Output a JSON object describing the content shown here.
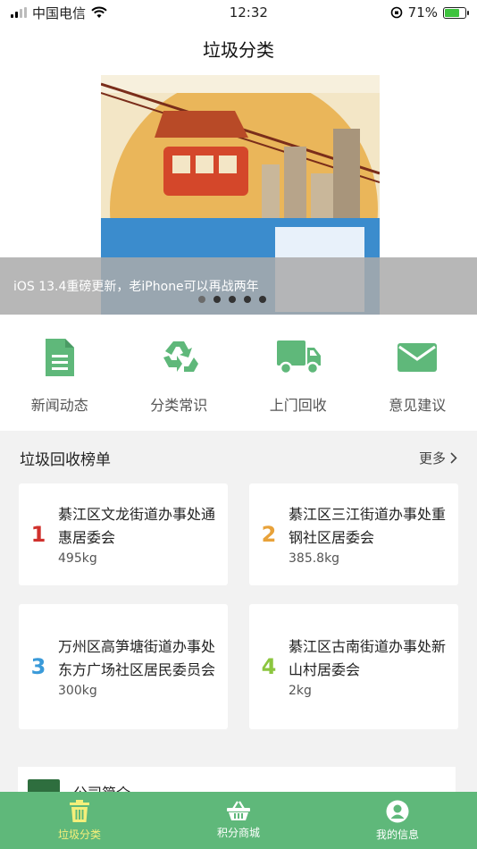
{
  "status_bar": {
    "carrier": "中国电信",
    "time": "12:32",
    "battery": "71%"
  },
  "nav": {
    "title": "垃圾分类"
  },
  "banner": {
    "caption": "iOS 13.4重磅更新，老iPhone可以再战两年",
    "slide_count": 5,
    "active_index": 0
  },
  "quick_menu": [
    {
      "label": "新闻动态",
      "icon": "document-icon"
    },
    {
      "label": "分类常识",
      "icon": "recycle-icon"
    },
    {
      "label": "上门回收",
      "icon": "truck-icon"
    },
    {
      "label": "意见建议",
      "icon": "envelope-icon"
    }
  ],
  "ranking": {
    "title": "垃圾回收榜单",
    "more": "更多",
    "items": [
      {
        "rank": "1",
        "name": "綦江区文龙街道办事处通惠居委会",
        "weight": "495kg",
        "color": "#d0312d"
      },
      {
        "rank": "2",
        "name": "綦江区三江街道办事处重钢社区居委会",
        "weight": "385.8kg",
        "color": "#e8a23a"
      },
      {
        "rank": "3",
        "name": "万州区高笋塘街道办事处东方广场社区居民委员会",
        "weight": "300kg",
        "color": "#3a9ad9"
      },
      {
        "rank": "4",
        "name": "綦江区古南街道办事处新山村居委会",
        "weight": "2kg",
        "color": "#8cc63f"
      }
    ]
  },
  "company": {
    "title": "公司简介"
  },
  "tab_bar": [
    {
      "label": "垃圾分类",
      "icon": "trash-icon",
      "active": true
    },
    {
      "label": "积分商城",
      "icon": "basket-icon",
      "active": false
    },
    {
      "label": "我的信息",
      "icon": "user-icon",
      "active": false
    }
  ],
  "colors": {
    "brand_green": "#5fb87a",
    "tab_active": "#f5ef7a"
  }
}
